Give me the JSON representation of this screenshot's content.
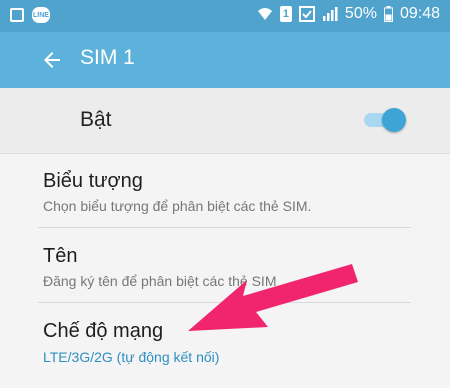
{
  "status_bar": {
    "line_badge": "LINE",
    "sim_number": "1",
    "battery": "50%",
    "time": "09:48"
  },
  "toolbar": {
    "title": "SIM 1",
    "back_icon": "arrow-back-icon"
  },
  "master_switch": {
    "label": "Bật",
    "state": "on",
    "accent": "#3ea4d6"
  },
  "settings": [
    {
      "title": "Biểu tượng",
      "subtitle": "Chọn biểu tượng để phân biệt các thẻ SIM."
    },
    {
      "title": "Tên",
      "subtitle": "Đăng ký tên để phân biệt các thẻ SIM"
    },
    {
      "title": "Chế độ mạng",
      "subtitle": "LTE/3G/2G (tự động kết nối)"
    }
  ],
  "annotation": {
    "arrow_color": "#f0256e"
  }
}
